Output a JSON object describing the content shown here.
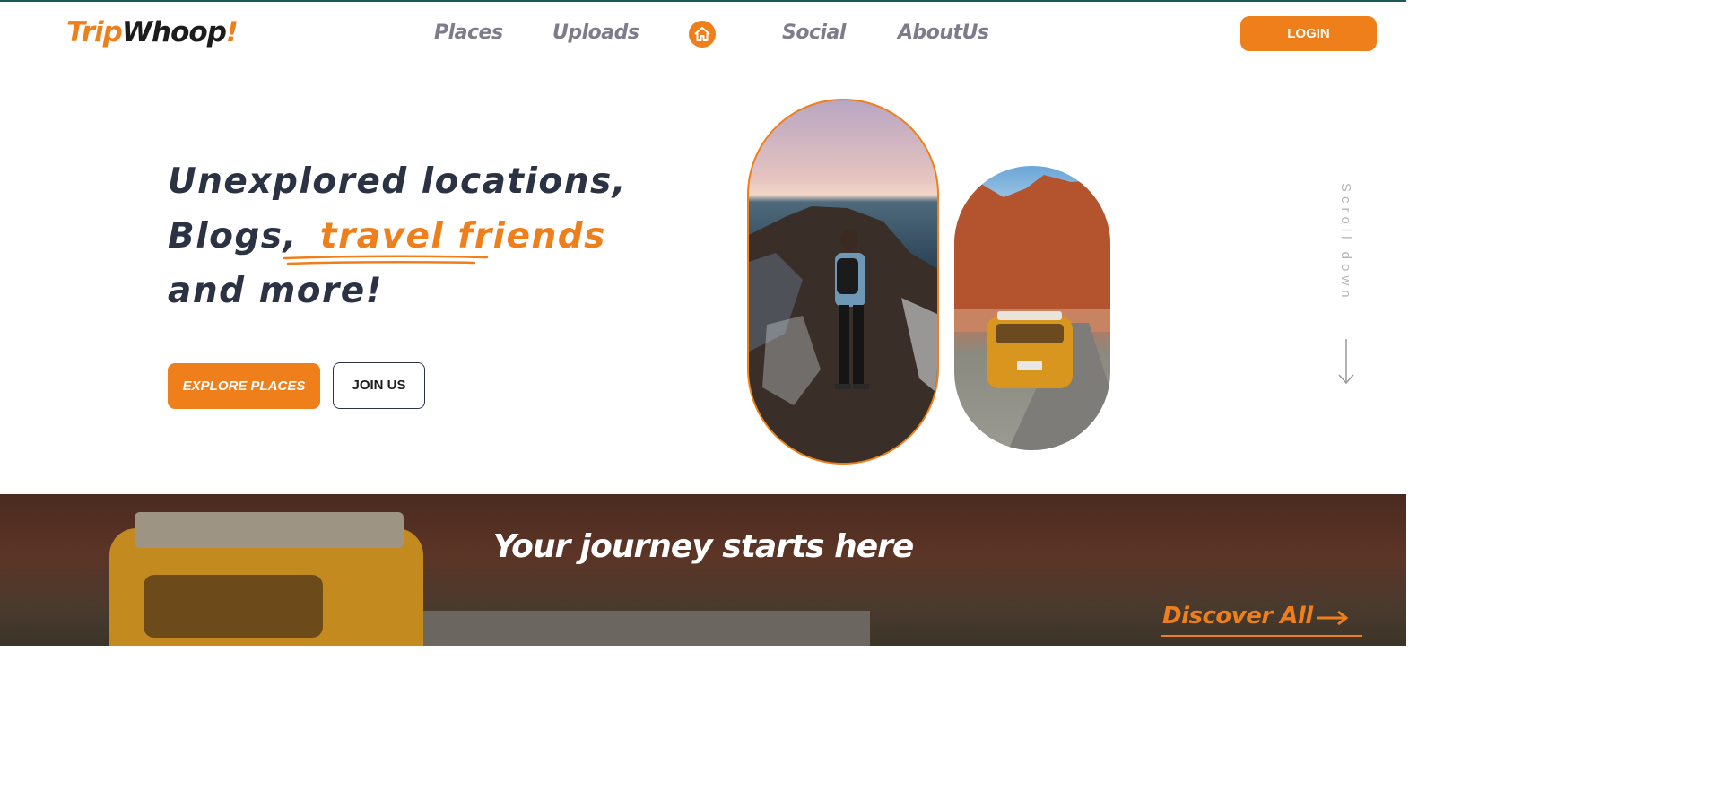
{
  "brand": {
    "part1": "Trip",
    "part2": "Whoop",
    "part3": "!"
  },
  "nav": {
    "items": [
      {
        "label": "Places"
      },
      {
        "label": "Uploads"
      },
      {
        "label": "Social"
      },
      {
        "label": "AboutUs"
      }
    ],
    "home_icon": "home-icon",
    "login_label": "LOGIN"
  },
  "hero": {
    "line1": "Unexplored locations,",
    "line2_prefix": "Blogs,",
    "line2_accent": "travel friends",
    "line3": "and more!",
    "explore_label": "EXPLORE PLACES",
    "join_label": "JOIN US",
    "scroll_label": "Scroll down"
  },
  "banner": {
    "title": "Your journey starts here",
    "discover_label": "Discover All"
  },
  "colors": {
    "accent": "#ee7f1b",
    "heading": "#2a3244",
    "nav": "#7f7a8c"
  }
}
